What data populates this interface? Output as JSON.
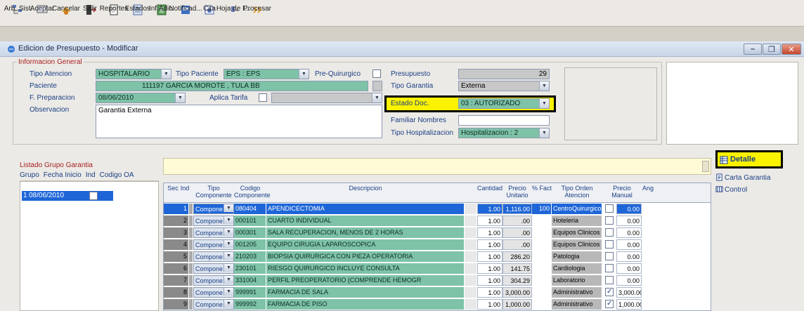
{
  "toolbar": {
    "buttons": [
      {
        "label": "Arb. Sist.",
        "icon": "tree-icon"
      },
      {
        "label": "Aceptar",
        "icon": "accept-icon"
      },
      {
        "label": "Cancelar",
        "icon": "cancel-icon"
      },
      {
        "label": "Salir",
        "icon": "exit-icon"
      },
      {
        "label": "Reportes",
        "icon": "report-icon"
      },
      {
        "label": "Estados",
        "icon": "states-icon"
      },
      {
        "label": "Inf.Adic.",
        "icon": "info-icon"
      },
      {
        "label": "Notificad...",
        "icon": "notify-icon"
      },
      {
        "label": "Cita",
        "icon": "appointment-icon"
      },
      {
        "label": "Hoja de I...",
        "icon": "sheet-icon"
      },
      {
        "label": "Procesar",
        "icon": "process-icon"
      }
    ]
  },
  "window": {
    "title": "Edicion de Presupuesto - Modificar"
  },
  "general": {
    "group_title": "Informacion General",
    "tipo_atencion_label": "Tipo Atencion",
    "tipo_atencion_value": "HOSPITALARIO",
    "tipo_paciente_label": "Tipo Paciente",
    "tipo_paciente_value": "EPS : EPS",
    "pre_quirurgico_label": "Pre-Quirurgico",
    "presupuesto_label": "Presupuesto",
    "presupuesto_value": "29",
    "paciente_label": "Paciente",
    "paciente_value": "111197 GARCIA MOROTE , TULA BB",
    "tipo_garantia_label": "Tipo Garantia",
    "tipo_garantia_value": "Externa",
    "f_preparacion_label": "F. Preparacion",
    "f_preparacion_value": "08/06/2010",
    "aplica_tarifa_label": "Aplica Tarifa",
    "estado_doc_label": "Estado Doc.",
    "estado_doc_value": "03 : AUTORIZADO",
    "observacion_label": "Observacion",
    "observacion_value": "Garantia Externa",
    "familiar_label": "Familiar Nombres",
    "tipo_hosp_label": "Tipo Hospitalizacion",
    "tipo_hosp_value": "Hospitalizacion : 2"
  },
  "list": {
    "title": "Listado Grupo Garantia",
    "headers": [
      "Grupo",
      "Fecha Inicio",
      "Ind",
      "Codigo OA"
    ],
    "row": {
      "grupo": "1",
      "fecha": "08/06/2010"
    }
  },
  "grid": {
    "headers": {
      "sec": "Sec",
      "ind": "Ind",
      "tipo": "Tipo Componente",
      "codigo": "Codigo Componente",
      "descripcion": "Descripcion",
      "cantidad": "Cantidad",
      "precio": "Precio Unitario",
      "pct": "% Fact",
      "orden": "Tipo Orden Atencion",
      "manual": "Precio Manual",
      "ang": "Ang"
    },
    "rows": [
      {
        "sec": "1",
        "tipo": "Compone",
        "codigo": "080404",
        "desc": "APENDICECTOMIA",
        "cant": "1.00",
        "precio": "1,116.00",
        "pct": "100",
        "orden": "CentroQuirurgico",
        "chk": false,
        "manual": "0.00",
        "sel": true
      },
      {
        "sec": "2",
        "tipo": "Compone",
        "codigo": "000101",
        "desc": "CUARTO INDIVIDUAL",
        "cant": "1.00",
        "precio": ".00",
        "pct": "",
        "orden": "Hoteleria",
        "chk": false,
        "manual": "0.00",
        "sel": false
      },
      {
        "sec": "3",
        "tipo": "Compone",
        "codigo": "000301",
        "desc": "SALA RECUPERACION, MENOS DE 2 HORAS",
        "cant": "1.00",
        "precio": ".00",
        "pct": "",
        "orden": "Equipos Clinicos",
        "chk": false,
        "manual": "0.00",
        "sel": false
      },
      {
        "sec": "4",
        "tipo": "Compone",
        "codigo": "001205",
        "desc": "EQUIPO CIRUGIA LAPAROSCOPICA",
        "cant": "1.00",
        "precio": ".00",
        "pct": "",
        "orden": "Equipos Clinicos",
        "chk": false,
        "manual": "0.00",
        "sel": false
      },
      {
        "sec": "5",
        "tipo": "Compone",
        "codigo": "210203",
        "desc": "BIOPSIA QUIRURGICA CON PIEZA OPERATORIA",
        "cant": "1.00",
        "precio": "286.20",
        "pct": "",
        "orden": "Patologia",
        "chk": false,
        "manual": "0.00",
        "sel": false
      },
      {
        "sec": "6",
        "tipo": "Compone",
        "codigo": "230101",
        "desc": "RIESGO QUIRURGICO INCLUYE CONSULTA",
        "cant": "1.00",
        "precio": "141.75",
        "pct": "",
        "orden": "Cardiologia",
        "chk": false,
        "manual": "0.00",
        "sel": false
      },
      {
        "sec": "7",
        "tipo": "Compone",
        "codigo": "331004",
        "desc": "PERFIL PREOPERATORIO (COMPRENDE HEMOGR",
        "cant": "1.00",
        "precio": "304.29",
        "pct": "",
        "orden": "Laboratorio",
        "chk": false,
        "manual": "0.00",
        "sel": false
      },
      {
        "sec": "8",
        "tipo": "Compone",
        "codigo": "999991",
        "desc": "FARMACIA DE SALA",
        "cant": "1.00",
        "precio": "3,000.00",
        "pct": "",
        "orden": "Administrativo",
        "chk": true,
        "manual": "3,000.00",
        "sel": false
      },
      {
        "sec": "9",
        "tipo": "Compone",
        "codigo": "999992",
        "desc": "FARMACIA DE PISO",
        "cant": "1.00",
        "precio": "1,000.00",
        "pct": "",
        "orden": "Administrativo",
        "chk": true,
        "manual": "1,000.00",
        "sel": false
      }
    ]
  },
  "side": {
    "detalle": "Detalle",
    "carta": "Carta Garantia",
    "control": "Control"
  },
  "colors": {
    "teal": "#7ec2a8",
    "selected": "#1e66d8",
    "highlight": "#fbf200"
  }
}
